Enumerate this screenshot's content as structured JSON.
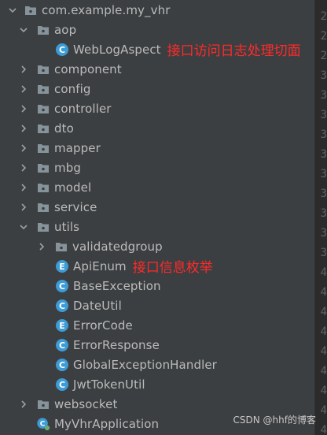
{
  "tree": {
    "root": "com.example.my_vhr",
    "aop": "aop",
    "web_log_aspect": "WebLogAspect",
    "web_log_aspect_note": "接口访问日志处理切面",
    "component": "component",
    "config": "config",
    "controller": "controller",
    "dto": "dto",
    "mapper": "mapper",
    "mbg": "mbg",
    "model": "model",
    "service": "service",
    "utils": "utils",
    "validatedgroup": "validatedgroup",
    "api_enum": "ApiEnum",
    "api_enum_note": "接口信息枚举",
    "base_exception": "BaseException",
    "date_util": "DateUtil",
    "error_code": "ErrorCode",
    "error_response": "ErrorResponse",
    "global_exception_handler": "GlobalExceptionHandler",
    "jwt_token_util": "JwtTokenUtil",
    "websocket": "websocket",
    "my_vhr_application": "MyVhrApplication"
  },
  "gutter": [
    "2",
    "2",
    "2",
    "3",
    "3",
    "3",
    "3",
    "3",
    "3",
    "3",
    "3",
    "3",
    "3",
    "4",
    "4",
    "4",
    "4",
    "4",
    "4",
    "4",
    "4",
    "4"
  ],
  "watermark": "CSDN @hhf的博客",
  "colors": {
    "background": "#3c3f41",
    "text": "#bbbbbb",
    "note": "#ff2a2a",
    "folder": "#87939a",
    "class_icon": "#3d9bd6",
    "enum_icon": "#3d9bd6"
  }
}
